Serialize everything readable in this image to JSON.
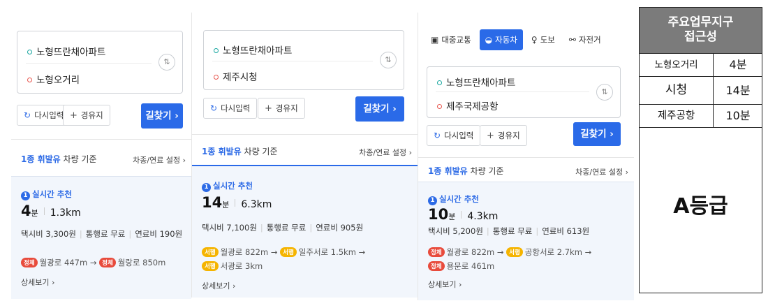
{
  "panel1": {
    "origin": "노형뜨란채아파트",
    "destination": "노형오거리",
    "reset_label": "다시입력",
    "waypoint_label": "경유지",
    "search_label": "길찾기 ›",
    "fuel_highlight": "1종 휘발유",
    "fuel_text": "차량 기준",
    "car_setting": "차종/연료 설정 ›",
    "rec_num": "1",
    "rec_label": "실시간 추천",
    "time_value": "4",
    "time_unit": "분",
    "distance": "1.3km",
    "taxi": "택시비 3,300원",
    "toll": "통행료 무료",
    "fuel_cost": "연료비 190원",
    "road_tag1": "정체",
    "road1": "월광로 447m →",
    "road_tag2": "정체",
    "road2": "월랑로 850m",
    "more": "상세보기 ›"
  },
  "panel2": {
    "origin": "노형뜨란채아파트",
    "destination": "제주시청",
    "reset_label": "다시입력",
    "waypoint_label": "경유지",
    "search_label": "길찾기 ›",
    "fuel_highlight": "1종 휘발유",
    "fuel_text": "차량 기준",
    "car_setting": "차종/연료 설정 ›",
    "rec_num": "1",
    "rec_label": "실시간 추천",
    "time_value": "14",
    "time_unit": "분",
    "distance": "6.3km",
    "taxi": "택시비 7,100원",
    "toll": "통행료 무료",
    "fuel_cost": "연료비 905원",
    "road_tag1": "서행",
    "road1": "월광로 822m →",
    "road_tag2": "서행",
    "road2": "일주서로 1.5km →",
    "road_tag3": "서행",
    "road3": "서광로 3km",
    "more": "상세보기 ›"
  },
  "panel3": {
    "tabs": [
      {
        "icon": "bus-icon",
        "glyph": "▣",
        "label": "대중교통"
      },
      {
        "icon": "car-icon",
        "glyph": "◒",
        "label": "자동차"
      },
      {
        "icon": "walk-icon",
        "glyph": "♀",
        "label": "도보"
      },
      {
        "icon": "bike-icon",
        "glyph": "⚯",
        "label": "자전거"
      }
    ],
    "origin": "노형뜨란채아파트",
    "destination": "제주국제공항",
    "reset_label": "다시입력",
    "waypoint_label": "경유지",
    "search_label": "길찾기 ›",
    "fuel_highlight": "1종 휘발유",
    "fuel_text": "차량 기준",
    "car_setting": "차종/연료 설정 ›",
    "rec_num": "1",
    "rec_label": "실시간 추천",
    "time_value": "10",
    "time_unit": "분",
    "distance": "4.3km",
    "taxi": "택시비 5,200원",
    "toll": "통행료 무료",
    "fuel_cost": "연료비 613원",
    "road_tag1": "정체",
    "road1": "월광로 822m →",
    "road_tag2": "서행",
    "road2": "공항서로 2.7km →",
    "road_tag3": "정체",
    "road3": "용문로 461m",
    "more": "상세보기 ›"
  },
  "table": {
    "title_line1": "주요업무지구",
    "title_line2": "접근성",
    "rows": [
      {
        "place": "노형오거리",
        "time": "4분"
      },
      {
        "place": "시청",
        "time": "14분"
      },
      {
        "place": "제주공항",
        "time": "10분"
      }
    ],
    "grade": "A등급"
  },
  "colors": {
    "accent": "#2a6ae8",
    "jam": "#e84b3c",
    "slow": "#f5b400",
    "origin_dot": "#19a7a0",
    "dest_dot": "#e8574f",
    "header_gray": "#7b7b7b"
  }
}
